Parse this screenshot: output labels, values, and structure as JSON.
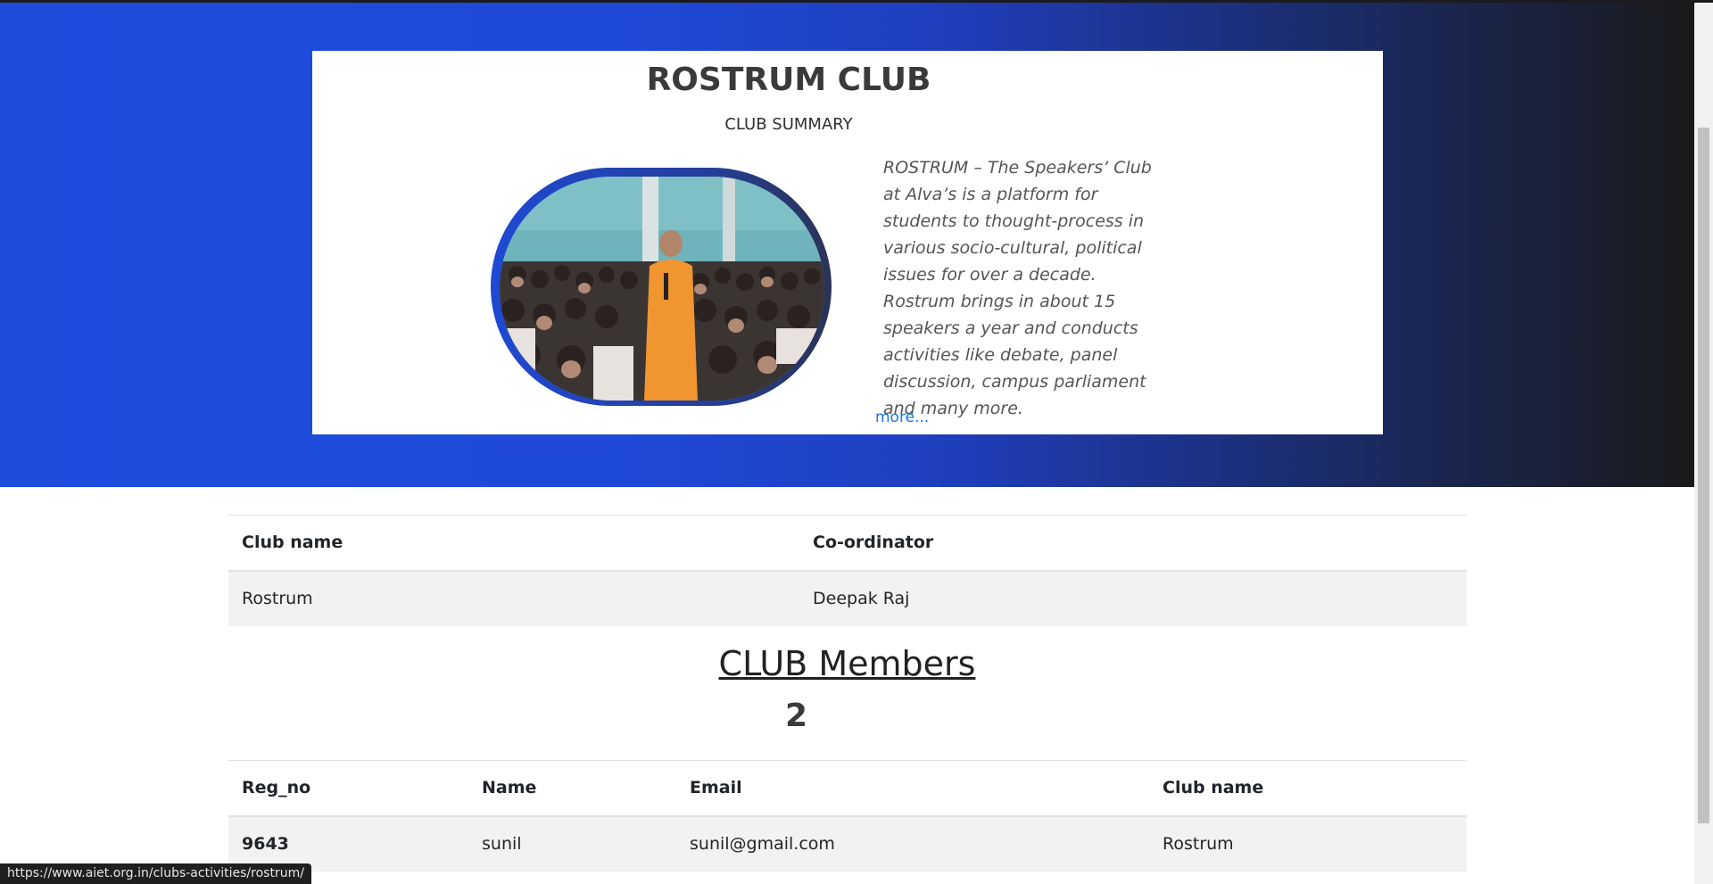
{
  "hero": {
    "title": "ROSTRUM CLUB",
    "subtitle": "CLUB SUMMARY",
    "description": "ROSTRUM – The Speakers’ Club at Alva’s is a platform for students to thought-process in various socio-cultural, political issues for over a decade. Rostrum brings in about 15 speakers a year and conducts activities like debate, panel discussion, campus parliament and many more.",
    "more_link": "more...",
    "photo_icon": "club-photo-image"
  },
  "club_table": {
    "headers": [
      "Club name",
      "Co-ordinator"
    ],
    "rows": [
      [
        "Rostrum",
        "Deepak Raj"
      ]
    ]
  },
  "members": {
    "title": "CLUB Members",
    "count": "2"
  },
  "members_table": {
    "headers": [
      "Reg_no",
      "Name",
      "Email",
      "Club name"
    ],
    "rows": [
      [
        "9643",
        "sunil",
        "sunil@gmail.com",
        "Rostrum"
      ]
    ]
  },
  "status_bar": {
    "url": "https://www.aiet.org.in/clubs-activities/rostrum/"
  },
  "colors": {
    "hero_gradient_start": "#1e4ddc",
    "hero_gradient_end": "#1a1a1a",
    "link": "#1a73e8"
  }
}
